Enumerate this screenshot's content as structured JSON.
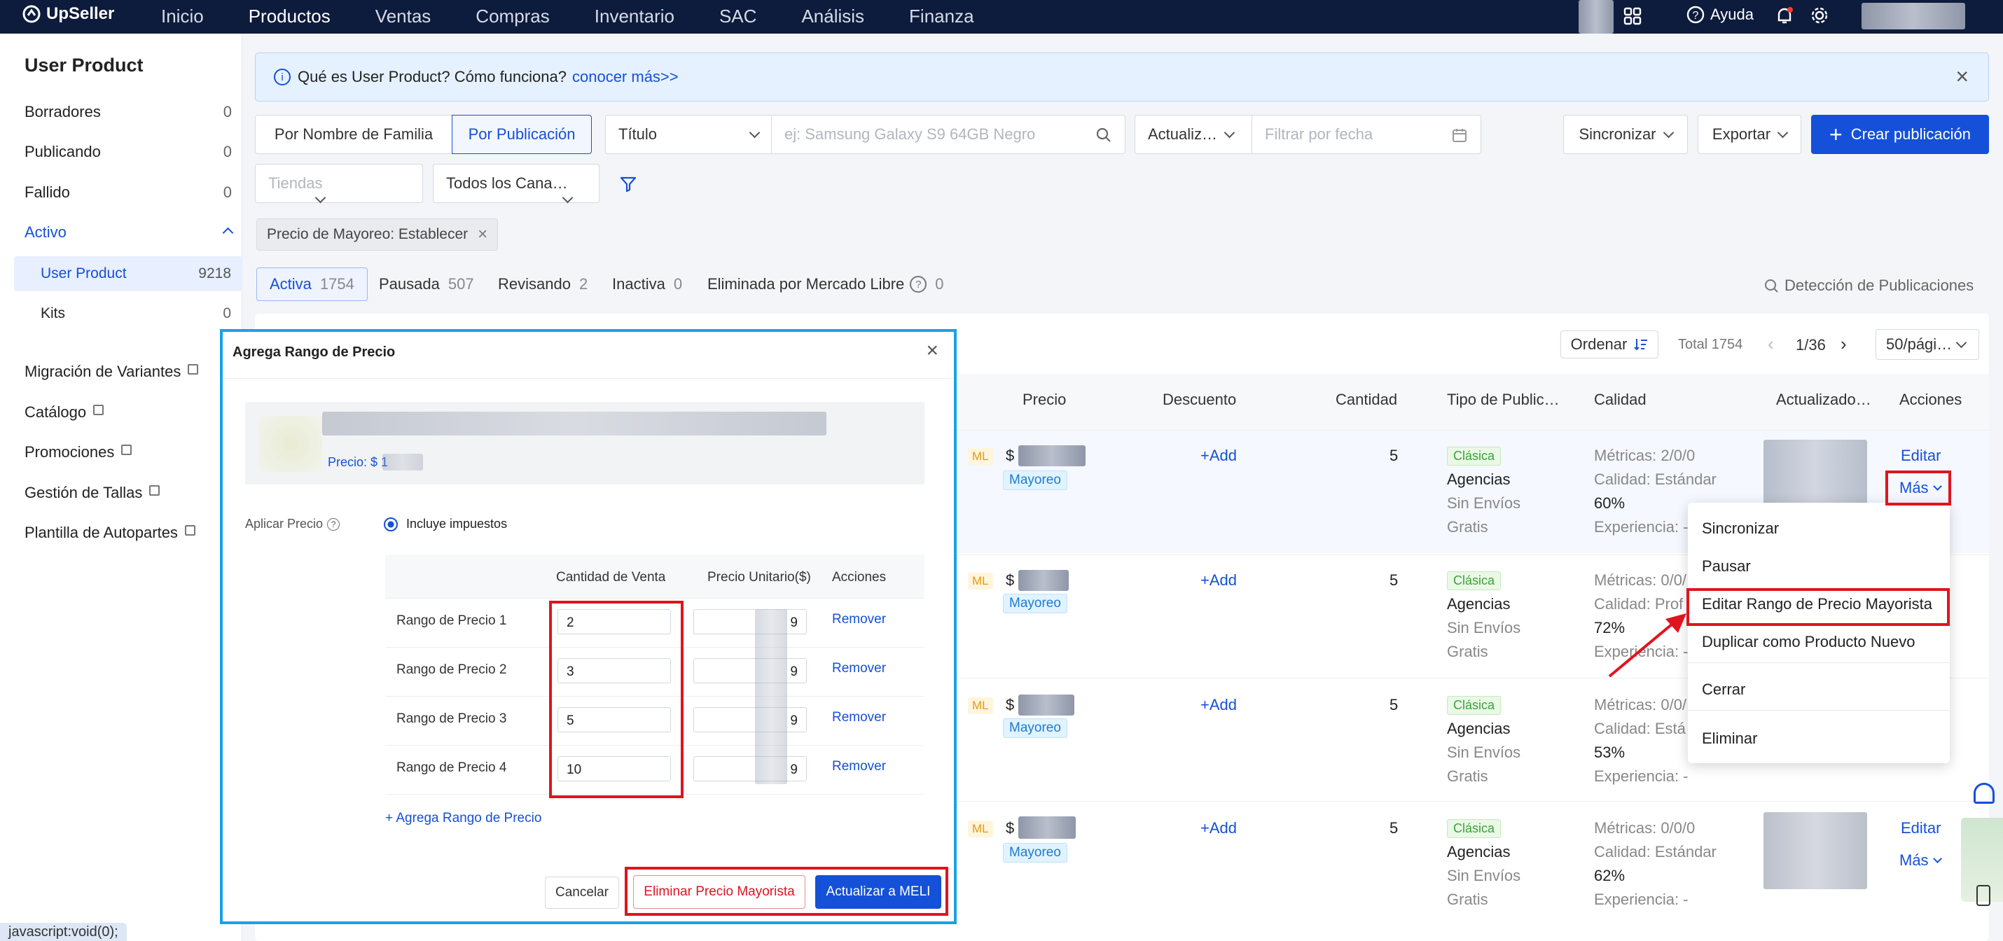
{
  "topnav": {
    "logo": "UpSeller",
    "items": [
      "Inicio",
      "Productos",
      "Ventas",
      "Compras",
      "Inventario",
      "SAC",
      "Análisis",
      "Finanza"
    ],
    "active": "Productos",
    "help": "Ayuda"
  },
  "sidebar": {
    "title": "User Product",
    "items": [
      {
        "label": "Borradores",
        "count": "0"
      },
      {
        "label": "Publicando",
        "count": "0"
      },
      {
        "label": "Fallido",
        "count": "0"
      },
      {
        "label": "Activo",
        "count": ""
      }
    ],
    "sub": [
      {
        "label": "User Product",
        "count": "9218"
      },
      {
        "label": "Kits",
        "count": "0"
      }
    ],
    "links": [
      "Migración de Variantes",
      "Catálogo",
      "Promociones",
      "Gestión de Tallas",
      "Plantilla de Autopartes"
    ]
  },
  "banner": {
    "text": "Qué es User Product? Cómo funciona?",
    "link": "conocer más>>"
  },
  "toolbar": {
    "by_family": "Por Nombre de Familia",
    "by_listing": "Por Publicación",
    "field": "Título",
    "search_placeholder": "ej: Samsung Galaxy S9 64GB Negro",
    "date_type": "Actualiz…",
    "date_placeholder": "Filtrar por fecha",
    "sync": "Sincronizar",
    "export": "Exportar",
    "create": "Crear publicación",
    "stores_placeholder": "Tiendas",
    "channels": "Todos los Cana…",
    "filter_tag": "Precio de Mayoreo: Establecer"
  },
  "status_tabs": [
    {
      "label": "Activa",
      "count": "1754"
    },
    {
      "label": "Pausada",
      "count": "507"
    },
    {
      "label": "Revisando",
      "count": "2"
    },
    {
      "label": "Inactiva",
      "count": "0"
    },
    {
      "label": "Eliminada por Mercado Libre",
      "count": "0"
    }
  ],
  "detection": "Detección de Publicaciones",
  "pager": {
    "order": "Ordenar",
    "total": "Total 1754",
    "page": "1/36",
    "per_page": "50/pági…"
  },
  "columns": [
    "Precio",
    "Descuento",
    "Cantidad",
    "Tipo de Public…",
    "Calidad",
    "Actualizado…",
    "Acciones"
  ],
  "rows": [
    {
      "ml": "ML",
      "currency": "$",
      "tag": "Mayoreo",
      "add": "+Add",
      "qty": "5",
      "type": "Clásica",
      "l1": "Agencias",
      "l2": "Sin Envíos",
      "l3": "Gratis",
      "q1": "Métricas: 2/0/0",
      "q2": "Calidad: Estándar",
      "q3": "60%",
      "q4": "Experiencia: -",
      "edit": "Editar",
      "more": "Más"
    },
    {
      "ml": "ML",
      "currency": "$",
      "tag": "Mayoreo",
      "add": "+Add",
      "qty": "5",
      "type": "Clásica",
      "l1": "Agencias",
      "l2": "Sin Envíos",
      "l3": "Gratis",
      "q1": "Métricas: 0/0/",
      "q2": "Calidad: Prof",
      "q3": "72%",
      "q4": "Experiencia: -",
      "edit": "",
      "more": ""
    },
    {
      "ml": "ML",
      "currency": "$",
      "tag": "Mayoreo",
      "add": "+Add",
      "qty": "5",
      "type": "Clásica",
      "l1": "Agencias",
      "l2": "Sin Envíos",
      "l3": "Gratis",
      "q1": "Métricas: 0/0/",
      "q2": "Calidad: Está",
      "q3": "53%",
      "q4": "Experiencia: -",
      "edit": "",
      "more": ""
    },
    {
      "ml": "ML",
      "currency": "$",
      "tag": "Mayoreo",
      "add": "+Add",
      "qty": "5",
      "type": "Clásica",
      "l1": "Agencias",
      "l2": "Sin Envíos",
      "l3": "Gratis",
      "q1": "Métricas: 0/0/0",
      "q2": "Calidad: Estándar",
      "q3": "62%",
      "q4": "Experiencia: -",
      "edit": "Editar",
      "more": "Más"
    }
  ],
  "dropdown": [
    "Sincronizar",
    "Pausar",
    "Editar Rango de Precio Mayorista",
    "Duplicar como Producto Nuevo",
    "Cerrar",
    "Eliminar"
  ],
  "modal": {
    "title": "Agrega Rango de Precio",
    "price_label": "Precio: $ 1",
    "apply_price": "Aplicar Precio",
    "includes_tax": "Incluye impuestos",
    "headers": [
      "Cantidad de Venta",
      "Precio Unitario($)",
      "Acciones"
    ],
    "ranges": [
      {
        "label": "Rango de Precio 1",
        "qty": "2",
        "price": "9",
        "action": "Remover"
      },
      {
        "label": "Rango de Precio 2",
        "qty": "3",
        "price": "9",
        "action": "Remover"
      },
      {
        "label": "Rango de Precio 3",
        "qty": "5",
        "price": "9",
        "action": "Remover"
      },
      {
        "label": "Rango de Precio 4",
        "qty": "10",
        "price": "9",
        "action": "Remover"
      }
    ],
    "add_range": "+ Agrega Rango de Precio",
    "cancel": "Cancelar",
    "delete": "Eliminar Precio Mayorista",
    "update": "Actualizar a MELI"
  },
  "statusbar": "javascript:void(0);",
  "colors": {
    "nav_bg": "#0d1b3c",
    "primary": "#1550d9",
    "highlight": "#e0141f",
    "modal_border": "#1aa1e6"
  }
}
